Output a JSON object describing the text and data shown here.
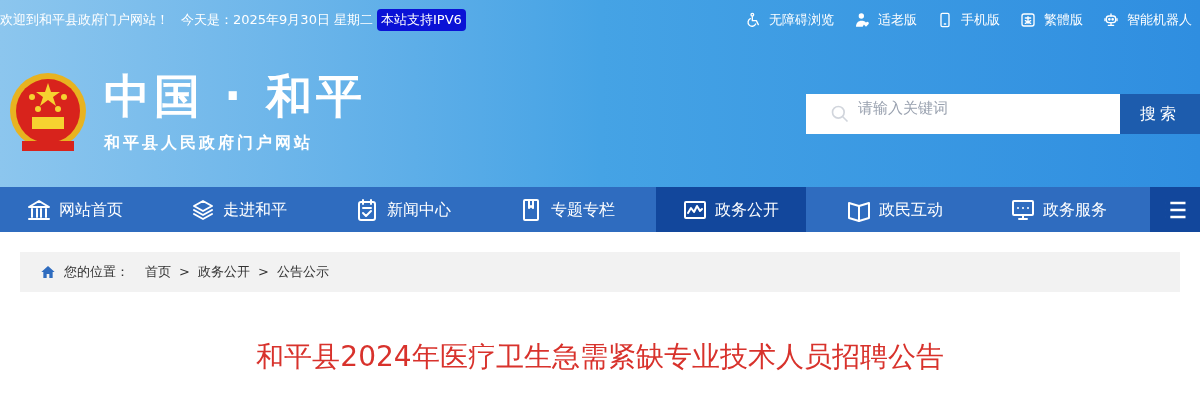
{
  "top_bar": {
    "welcome": "欢迎到和平县政府门户网站！",
    "date": "今天是：2025年9月30日 星期二",
    "ipv6_badge": "本站支持IPV6",
    "links": [
      {
        "label": "无障碍浏览"
      },
      {
        "label": "适老版"
      },
      {
        "label": "手机版"
      },
      {
        "label": "繁體版"
      },
      {
        "label": "智能机器人"
      }
    ]
  },
  "header": {
    "title": "中国 · 和平",
    "subtitle": "和平县人民政府门户网站",
    "search": {
      "placeholder": "请输入关键词",
      "button": "搜索"
    }
  },
  "nav": [
    {
      "label": "网站首页",
      "selected": false
    },
    {
      "label": "走进和平",
      "selected": false
    },
    {
      "label": "新闻中心",
      "selected": false
    },
    {
      "label": "专题专栏",
      "selected": false
    },
    {
      "label": "政务公开",
      "selected": true
    },
    {
      "label": "政民互动",
      "selected": false
    },
    {
      "label": "政务服务",
      "selected": false
    }
  ],
  "breadcrumb": {
    "label": "您的位置：",
    "items": [
      "首页",
      "政务公开",
      "公告公示"
    ],
    "separator": ">"
  },
  "article": {
    "title": "和平县2024年医疗卫生急需紧缺专业技术人员招聘公告"
  }
}
